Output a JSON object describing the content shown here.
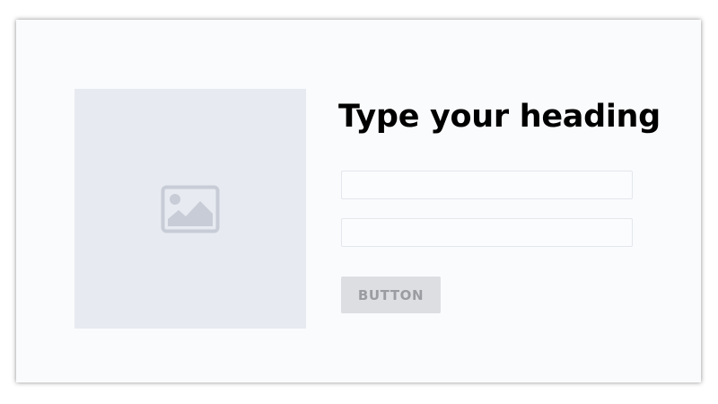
{
  "form": {
    "image_icon": "image-icon",
    "heading": "Type your heading",
    "fields": [
      {
        "value": "",
        "placeholder": ""
      },
      {
        "value": "",
        "placeholder": ""
      }
    ],
    "button_label": "BUTTON"
  },
  "colors": {
    "card_background": "#fafbfd",
    "image_placeholder": "#e7eaf0",
    "icon": "#c7ccd6",
    "button_background": "#dcdee2",
    "button_text": "#9a9ca1"
  }
}
